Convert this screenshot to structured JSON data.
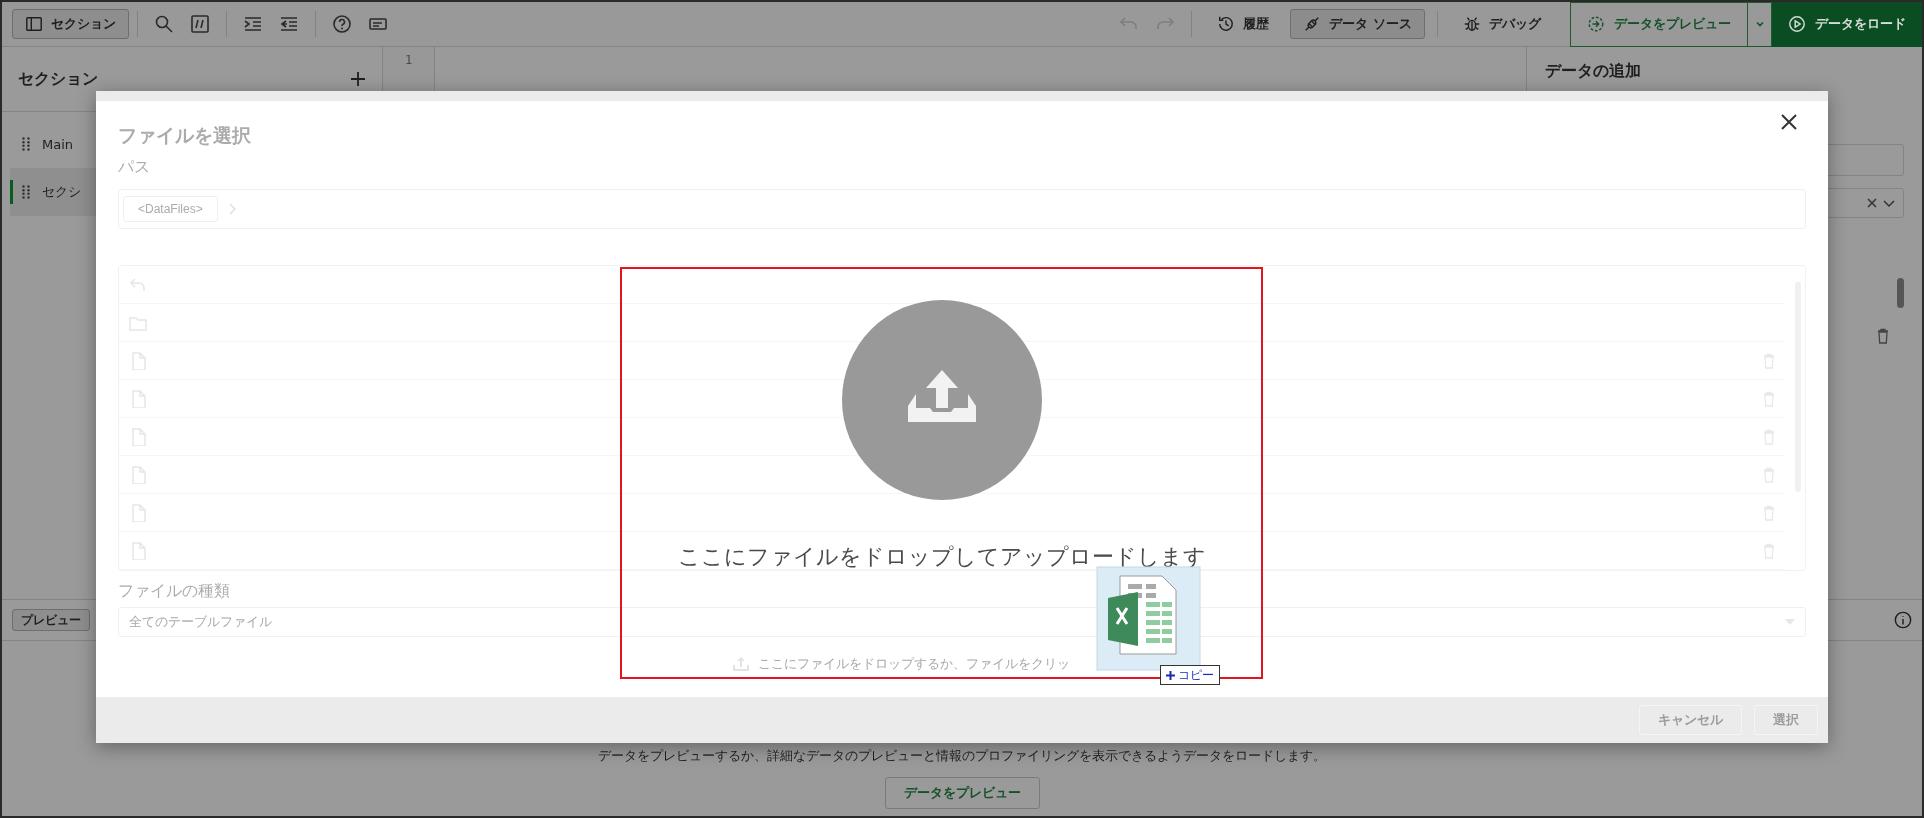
{
  "toolbar": {
    "sections_button": "セクション",
    "icons": [
      {
        "kind": "search"
      },
      {
        "kind": "comment"
      },
      {
        "kind": "indent"
      },
      {
        "kind": "outdent"
      },
      {
        "kind": "help"
      },
      {
        "kind": "textbox"
      }
    ],
    "history_nav": [
      {
        "kind": "undo",
        "disabled": true
      },
      {
        "kind": "redo",
        "disabled": true
      }
    ],
    "tools": [
      {
        "label": "履歴",
        "kind": "history",
        "selected": false
      },
      {
        "label": "データ ソース",
        "kind": "datasource",
        "selected": true
      },
      {
        "label": "デバッグ",
        "kind": "debug",
        "selected": false
      }
    ],
    "preview_button": "データをプレビュー",
    "load_button": "データをロード"
  },
  "sections_panel": {
    "title": "セクション",
    "items": [
      {
        "label": "Main",
        "selected": false
      },
      {
        "label": "セクシ",
        "selected": true
      }
    ]
  },
  "editor": {
    "line_numbers": [
      "1"
    ]
  },
  "right_panel": {
    "title": "データの追加"
  },
  "bottom_panel": {
    "preview_tab": "プレビュー",
    "message": "データをプレビューするか、詳細なデータのプレビューと情報のプロファイリングを表示できるようデータをロードします。",
    "button": "データをプレビュー"
  },
  "dialog": {
    "title": "ファイルを選択",
    "path_label": "パス",
    "path_chip": "<DataFiles>",
    "file_rows": [
      {
        "kind": "up"
      },
      {
        "kind": "folder"
      },
      {
        "kind": "file"
      },
      {
        "kind": "file"
      },
      {
        "kind": "file"
      },
      {
        "kind": "file"
      },
      {
        "kind": "file"
      },
      {
        "kind": "file"
      }
    ],
    "file_type_label": "ファイルの種類",
    "file_type_value": "全てのテーブルファイル",
    "upload_hint": "ここにファイルをドロップするか、ファイルをクリッ",
    "buttons": [
      {
        "label": "キャンセル"
      },
      {
        "label": "選択"
      }
    ]
  },
  "drop_zone": {
    "message": "ここにファイルをドロップしてアップロードします"
  },
  "drag_badge": {
    "label": "コピー"
  }
}
